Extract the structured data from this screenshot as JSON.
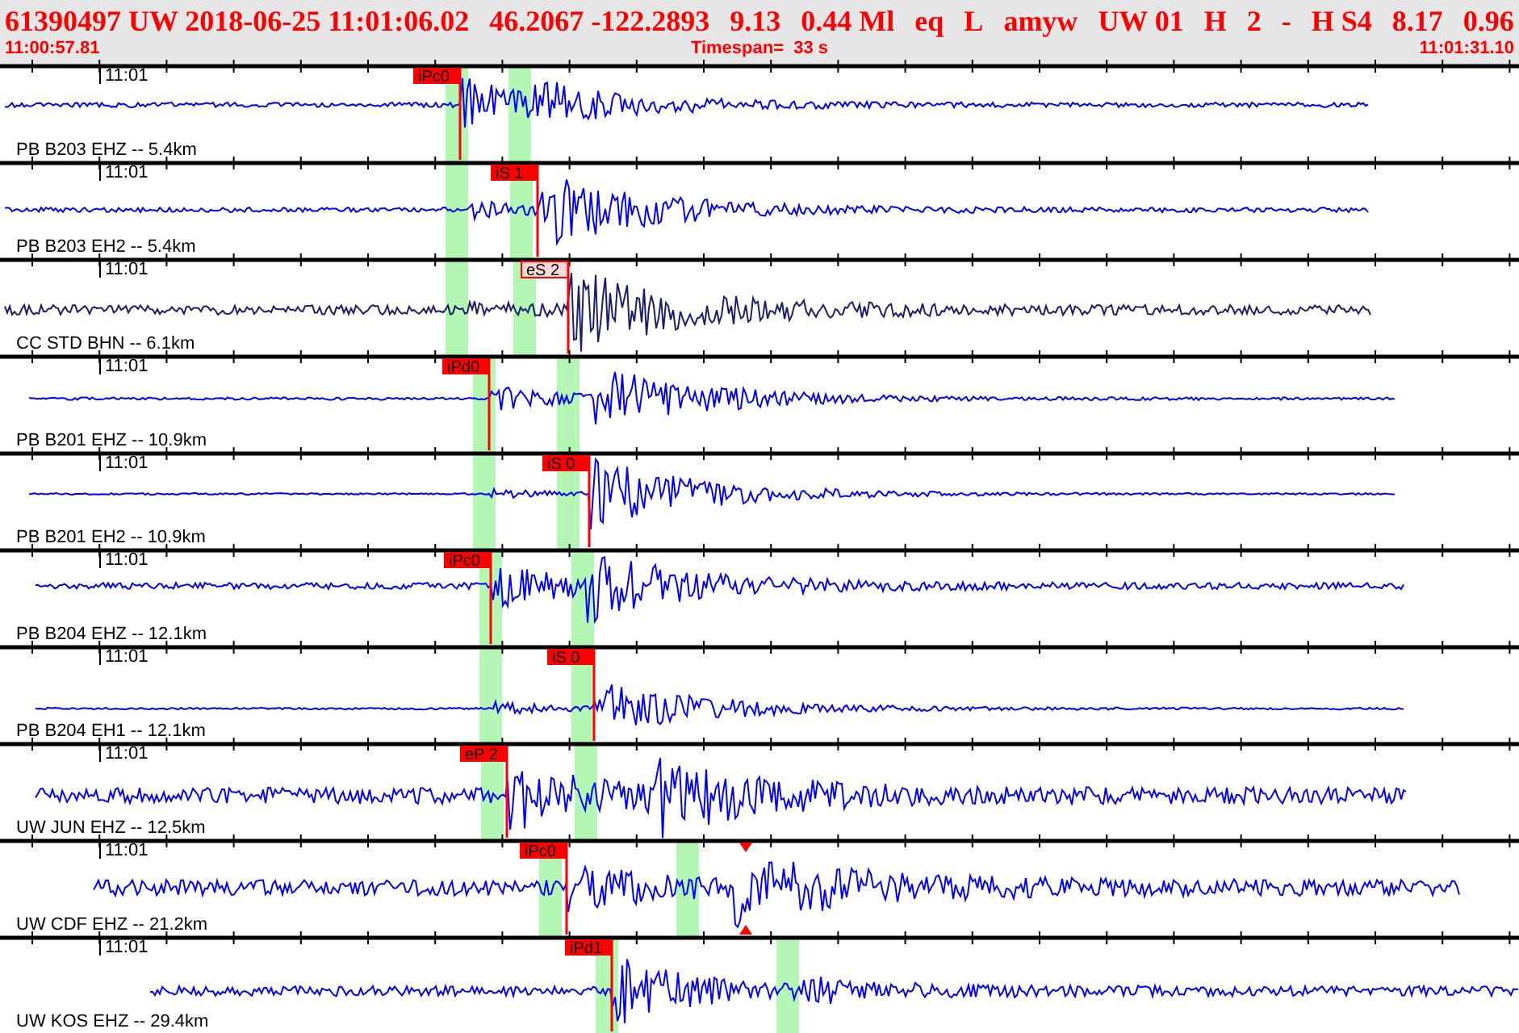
{
  "header": {
    "summary": [
      "61390497 UW 2018-06-25 11:01:06.02",
      "46.2067 -122.2893",
      "9.13",
      "0.44 Ml",
      "eq",
      "L",
      "amyw",
      "UW 01",
      "H",
      "2",
      "-",
      "H S4",
      "8.17",
      "0.96"
    ],
    "start_time": "11:00:57.81",
    "timespan": "Timespan=  33 s",
    "end_time": "11:01:31.10"
  },
  "traces": [
    {
      "station": "PB B203 EHZ -- 5.4km",
      "time_label": "11:01",
      "color": "#0000ff",
      "picks": [
        {
          "label": "iPc0",
          "kind": "solid"
        }
      ]
    },
    {
      "station": "PB B203 EH2 -- 5.4km",
      "time_label": "11:01",
      "color": "#0000ff",
      "picks": [
        {
          "label": "iS 1",
          "kind": "solid"
        }
      ]
    },
    {
      "station": "CC STD BHN -- 6.1km",
      "time_label": "11:01",
      "color": "#1c1c6e",
      "picks": [
        {
          "label": "eS 2",
          "kind": "light"
        }
      ]
    },
    {
      "station": "PB B201 EHZ -- 10.9km",
      "time_label": "11:01",
      "color": "#0000ff",
      "picks": [
        {
          "label": "iPd0",
          "kind": "solid"
        }
      ]
    },
    {
      "station": "PB B201 EH2 -- 10.9km",
      "time_label": "11:01",
      "color": "#0000ff",
      "picks": [
        {
          "label": "iS 0",
          "kind": "solid"
        }
      ]
    },
    {
      "station": "PB B204 EHZ -- 12.1km",
      "time_label": "11:01",
      "color": "#0000ff",
      "picks": [
        {
          "label": "iPc0",
          "kind": "solid"
        }
      ]
    },
    {
      "station": "PB B204 EH1 -- 12.1km",
      "time_label": "11:01",
      "color": "#0000ff",
      "picks": [
        {
          "label": "iS 0",
          "kind": "solid"
        }
      ]
    },
    {
      "station": "UW JUN EHZ -- 12.5km",
      "time_label": "11:01",
      "color": "#0000ff",
      "picks": [
        {
          "label": "eP 2",
          "kind": "solid"
        }
      ]
    },
    {
      "station": "UW CDF EHZ -- 21.2km",
      "time_label": "11:01",
      "color": "#0000ff",
      "picks": [
        {
          "label": "iPc0",
          "kind": "solid"
        },
        {
          "kind": "marker"
        }
      ]
    },
    {
      "station": "UW KOS EHZ -- 29.4km",
      "time_label": "11:01",
      "color": "#0000ff",
      "picks": [
        {
          "label": "iPd1",
          "kind": "solid"
        }
      ]
    }
  ]
}
